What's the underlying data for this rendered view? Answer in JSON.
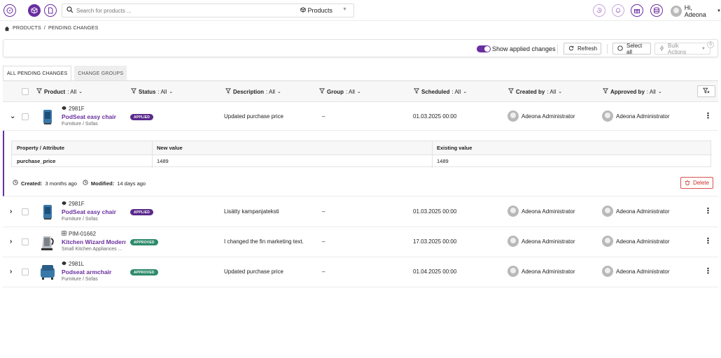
{
  "topbar": {
    "left_icons": [
      "compass-icon",
      "cube-icon",
      "document-icon"
    ],
    "search_placeholder": "Search for products ...",
    "search_scope": "Products",
    "right_icons": [
      "history-icon",
      "bell-icon",
      "gift-icon",
      "database-icon"
    ],
    "user_greeting": "Hi, Adeona"
  },
  "breadcrumb": {
    "home": "PRODUCTS",
    "sep": "/",
    "current": "PENDING CHANGES"
  },
  "toolbar": {
    "show_applied_label": "Show applied changes",
    "show_applied_on": true,
    "refresh_label": "Refresh",
    "select_all_label": "Select all",
    "bulk_actions_label": "Bulk Actions",
    "bulk_count": "0"
  },
  "tabs": [
    {
      "label": "ALL PENDING CHANGES",
      "active": true
    },
    {
      "label": "CHANGE GROUPS",
      "active": false
    }
  ],
  "columns": {
    "product": {
      "label": "Product",
      "filter": ": All"
    },
    "status": {
      "label": "Status",
      "filter": ": All"
    },
    "description": {
      "label": "Description",
      "filter": ": All"
    },
    "group": {
      "label": "Group",
      "filter": ": All"
    },
    "scheduled": {
      "label": "Scheduled",
      "filter": ": All"
    },
    "created_by": {
      "label": "Created by",
      "filter": ": All"
    },
    "approved_by": {
      "label": "Approved by",
      "filter": ": All"
    }
  },
  "rows": [
    {
      "sku": "2981F",
      "name": "PodSeat easy chair",
      "category": "Furniture / Sofas",
      "status": "APPLIED",
      "description": "Updated purchase price",
      "group": "–",
      "scheduled": "01.03.2025 00:00",
      "created_by": "Adeona Administrator",
      "approved_by": "Adeona Administrator",
      "expanded": true
    },
    {
      "sku": "2981F",
      "name": "PodSeat easy chair",
      "category": "Furniture / Sofas",
      "status": "APPLIED",
      "description": "Lisätty kampanjateksti",
      "group": "–",
      "scheduled": "01.03.2025 00:00",
      "created_by": "Adeona Administrator",
      "approved_by": "Adeona Administrator",
      "expanded": false
    },
    {
      "sku": "PIM-01662",
      "name": "Kitchen Wizard Modern w",
      "category": "Small Kitchen Appliances ...",
      "status": "APPROVED",
      "description": "I changed the fin marketing text.",
      "group": "–",
      "scheduled": "17.03.2025 00:00",
      "created_by": "Adeona Administrator",
      "approved_by": "Adeona Administrator",
      "expanded": false
    },
    {
      "sku": "2981L",
      "name": "Podseat armchair",
      "category": "Furniture / Sofas",
      "status": "APPROVED",
      "description": "Updated purchase price",
      "group": "–",
      "scheduled": "01.04.2025 00:00",
      "created_by": "Adeona Administrator",
      "approved_by": "Adeona Administrator",
      "expanded": false
    }
  ],
  "detail": {
    "headers": [
      "Property / Attribute",
      "New value",
      "Existing value"
    ],
    "row": [
      "purchase_price",
      "1489",
      "1489"
    ],
    "created_label": "Created:",
    "created_value": "3 months ago",
    "modified_label": "Modified:",
    "modified_value": "14 days ago",
    "delete_label": "Delete"
  },
  "colors": {
    "brand": "#6a2ea0",
    "applied": "#5a2a8c",
    "approved": "#2e8a6b",
    "danger": "#d9534f"
  }
}
